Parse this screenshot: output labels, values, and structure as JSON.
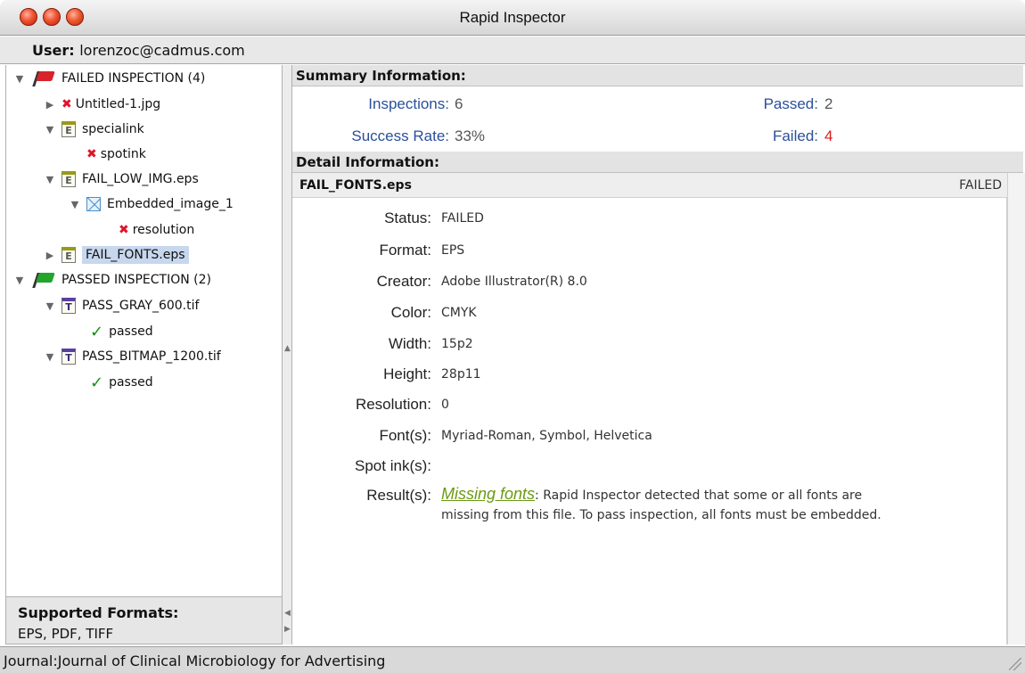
{
  "window": {
    "title": "Rapid Inspector"
  },
  "user": {
    "label": "User:",
    "value": "lorenzoc@cadmus.com"
  },
  "tree": {
    "failed_group": "FAILED INSPECTION (4)",
    "untitled": "Untitled-1.jpg",
    "specialink": "specialink",
    "spotink": "spotink",
    "fail_low": "FAIL_LOW_IMG.eps",
    "embedded": "Embedded_image_1",
    "resolution": "resolution",
    "fail_fonts": "FAIL_FONTS.eps",
    "passed_group": "PASSED INSPECTION (2)",
    "pass_gray": "PASS_GRAY_600.tif",
    "passed1": "passed",
    "pass_bitmap": "PASS_BITMAP_1200.tif",
    "passed2": "passed"
  },
  "supported": {
    "heading": "Supported Formats:",
    "value": "EPS, PDF, TIFF"
  },
  "summary": {
    "heading": "Summary Information:",
    "inspections_label": "Inspections:",
    "inspections_value": "6",
    "passed_label": "Passed:",
    "passed_value": "2",
    "success_label": "Success Rate:",
    "success_value": "33%",
    "failed_label": "Failed:",
    "failed_value": "4"
  },
  "detail": {
    "heading": "Detail Information:",
    "file_name": "FAIL_FONTS.eps",
    "file_status": "FAILED",
    "status_label": "Status:",
    "status_value": "FAILED",
    "format_label": "Format:",
    "format_value": "EPS",
    "creator_label": "Creator:",
    "creator_value": "Adobe Illustrator(R) 8.0",
    "color_label": "Color:",
    "color_value": "CMYK",
    "width_label": "Width:",
    "width_value": "15p2",
    "height_label": "Height:",
    "height_value": "28p11",
    "resolution_label": "Resolution:",
    "resolution_value": "0",
    "fonts_label": "Font(s):",
    "fonts_value": "Myriad-Roman, Symbol, Helvetica",
    "spot_label": "Spot ink(s):",
    "spot_value": "",
    "result_label": "Result(s):",
    "result_link": "Missing  fonts",
    "result_text_1": ": Rapid Inspector detected that some or all fonts are",
    "result_text_2": "missing from this file. To pass inspection, all fonts must be embedded."
  },
  "status_bar": {
    "text": "Journal:Journal of Clinical Microbiology for Advertising"
  },
  "colors": {
    "failed_red": "#d41d1d",
    "label_blue": "#2a4f9a",
    "link_green": "#6a9a12",
    "selection": "#c7d7ee"
  }
}
